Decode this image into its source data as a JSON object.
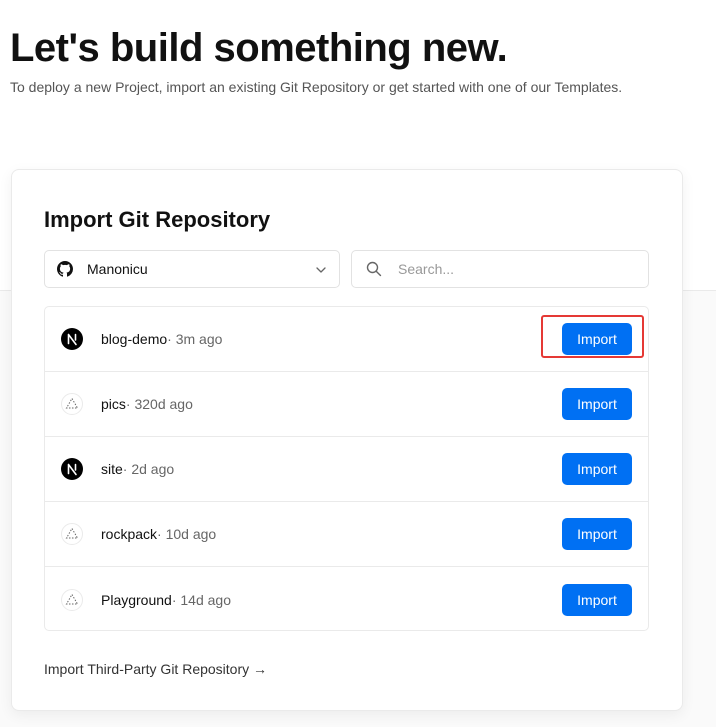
{
  "header": {
    "title": "Let's build something new.",
    "subtitle": "To deploy a new Project, import an existing Git Repository or get started with one of our Templates."
  },
  "import_card": {
    "title": "Import Git Repository",
    "account_selector": {
      "value": "Manonicu",
      "icon": "github-icon"
    },
    "search": {
      "placeholder": "Search..."
    },
    "repos": [
      {
        "name": "blog-demo",
        "meta": " · 3m ago",
        "icon": "nextjs-icon",
        "button": "Import",
        "highlighted": true
      },
      {
        "name": "pics",
        "meta": " · 320d ago",
        "icon": "vercel-triangle-icon",
        "button": "Import",
        "highlighted": false
      },
      {
        "name": "site",
        "meta": " · 2d ago",
        "icon": "nextjs-icon",
        "button": "Import",
        "highlighted": false
      },
      {
        "name": "rockpack",
        "meta": " · 10d ago",
        "icon": "vercel-triangle-icon",
        "button": "Import",
        "highlighted": false
      },
      {
        "name": "Playground",
        "meta": " · 14d ago",
        "icon": "vercel-triangle-icon",
        "button": "Import",
        "highlighted": false
      }
    ],
    "third_party_link": "Import Third-Party Git Repository →"
  },
  "colors": {
    "accent": "#0070f3",
    "highlight": "#e53935"
  }
}
